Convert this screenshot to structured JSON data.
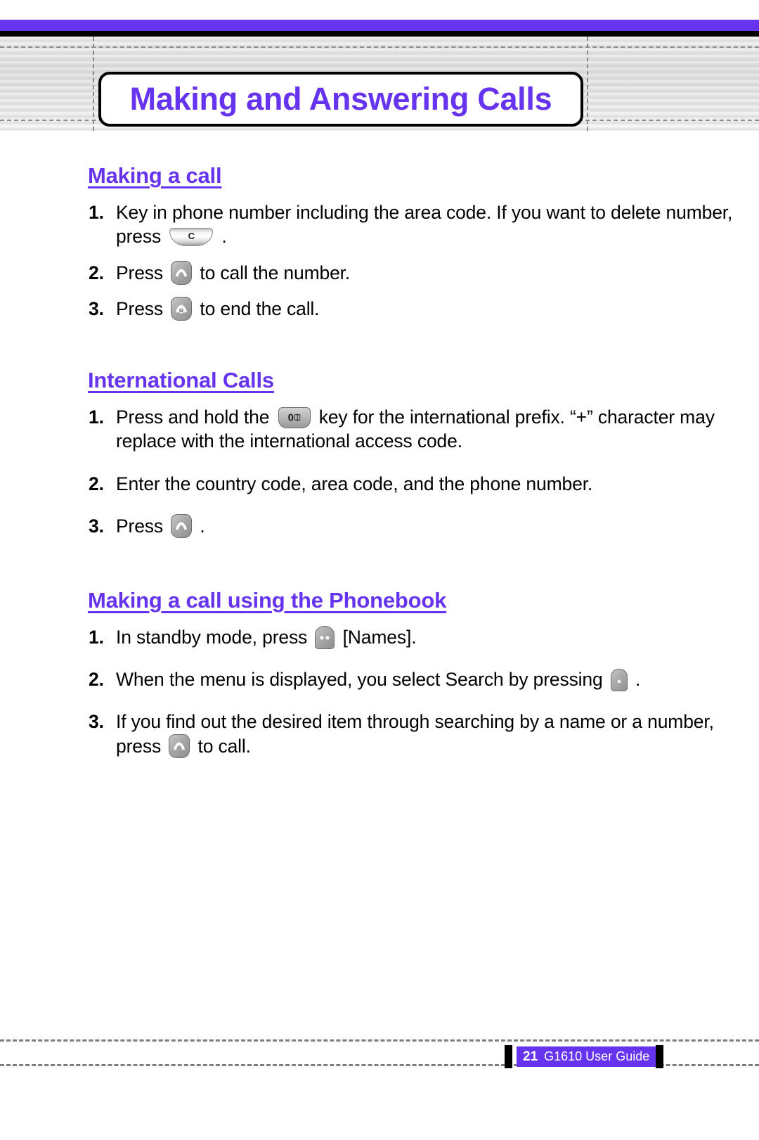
{
  "page": {
    "title": "Making and Answering Calls",
    "accent_color": "#6633ee",
    "rule_color_black": "#000000"
  },
  "sections": [
    {
      "heading": "Making a call",
      "steps": [
        {
          "number": "1.",
          "parts": [
            {
              "type": "text",
              "value": "Key in phone number including the area code. If you want to delete number, press "
            },
            {
              "type": "icon",
              "icon": "clear-key",
              "label": "C"
            },
            {
              "type": "text",
              "value": " ."
            }
          ]
        },
        {
          "number": "2.",
          "parts": [
            {
              "type": "text",
              "value": "Press "
            },
            {
              "type": "icon",
              "icon": "send-key"
            },
            {
              "type": "text",
              "value": " to call the number."
            }
          ]
        },
        {
          "number": "3.",
          "parts": [
            {
              "type": "text",
              "value": "Press "
            },
            {
              "type": "icon",
              "icon": "end-key"
            },
            {
              "type": "text",
              "value": " to end the call."
            }
          ]
        }
      ]
    },
    {
      "heading": "International Calls",
      "steps": [
        {
          "number": "1.",
          "parts": [
            {
              "type": "text",
              "value": "Press and hold the "
            },
            {
              "type": "icon",
              "icon": "zero-key",
              "label": "0"
            },
            {
              "type": "text",
              "value": " key for the international prefix. “+” character may replace with the international access code."
            }
          ]
        },
        {
          "number": "2.",
          "parts": [
            {
              "type": "text",
              "value": "Enter the country code, area code, and the phone number."
            }
          ]
        },
        {
          "number": "3.",
          "parts": [
            {
              "type": "text",
              "value": "Press "
            },
            {
              "type": "icon",
              "icon": "send-key"
            },
            {
              "type": "text",
              "value": " ."
            }
          ]
        }
      ]
    },
    {
      "heading": "Making a call using the Phonebook",
      "steps": [
        {
          "number": "1.",
          "parts": [
            {
              "type": "text",
              "value": "In standby mode, press "
            },
            {
              "type": "icon",
              "icon": "left-soft-key"
            },
            {
              "type": "text",
              "value": " [Names]."
            }
          ]
        },
        {
          "number": "2.",
          "parts": [
            {
              "type": "text",
              "value": "When the menu is displayed, you select Search by pressing "
            },
            {
              "type": "icon",
              "icon": "right-soft-key"
            },
            {
              "type": "text",
              "value": " ."
            }
          ]
        },
        {
          "number": "3.",
          "parts": [
            {
              "type": "text",
              "value": "If you find out the desired item through searching by a name or a number, press "
            },
            {
              "type": "icon",
              "icon": "send-key"
            },
            {
              "type": "text",
              "value": " to call."
            }
          ]
        }
      ]
    }
  ],
  "footer": {
    "page_number": "21",
    "guide_label": "G1610 User Guide"
  }
}
